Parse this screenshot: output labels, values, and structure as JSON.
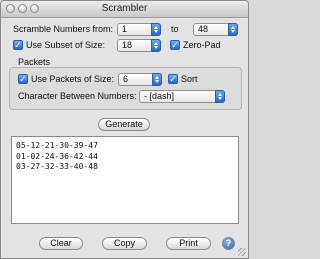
{
  "window": {
    "title": "Scrambler"
  },
  "scramble": {
    "from_label": "Scramble Numbers from:",
    "from_value": "1",
    "to_label": "to",
    "to_value": "48"
  },
  "subset": {
    "label": "Use Subset of Size:",
    "checked": true,
    "value": "18",
    "zero_pad_label": "Zero-Pad",
    "zero_pad_checked": true
  },
  "packets": {
    "heading": "Packets",
    "use_label": "Use Packets of Size:",
    "use_checked": true,
    "size_value": "6",
    "sort_label": "Sort",
    "sort_checked": true,
    "between_label": "Character Between Numbers:",
    "between_value": "- [dash]"
  },
  "buttons": {
    "generate": "Generate",
    "clear": "Clear",
    "copy": "Copy",
    "print": "Print",
    "help": "?"
  },
  "output": {
    "lines": [
      "05-12-21-30-39-47",
      "01-02-24-36-42-44",
      "03-27-32-33-40-48"
    ]
  },
  "colors": {
    "accent": "#2b68ca",
    "window_bg": "#e3e3e3"
  }
}
